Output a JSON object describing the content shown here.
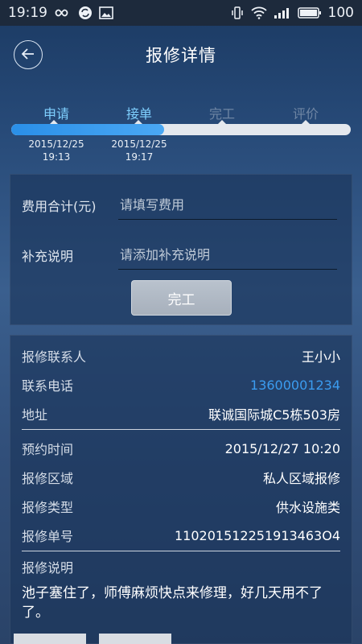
{
  "status_bar": {
    "time": "19:19",
    "battery": "100"
  },
  "header": {
    "title": "报修详情"
  },
  "progress": {
    "fraction_complete": 0.45,
    "steps": [
      {
        "label": "申请",
        "active": true,
        "date": "2015/12/25",
        "time": "19:13"
      },
      {
        "label": "接单",
        "active": true,
        "date": "2015/12/25",
        "time": "19:17"
      },
      {
        "label": "完工",
        "active": false,
        "date": "",
        "time": ""
      },
      {
        "label": "评价",
        "active": false,
        "date": "",
        "time": ""
      }
    ]
  },
  "form": {
    "cost_label": "费用合计(元)",
    "cost_placeholder": "请填写费用",
    "note_label": "补充说明",
    "note_placeholder": "请添加补充说明",
    "complete_button": "完工"
  },
  "details": {
    "contact_key": "报修联系人",
    "contact_val": "王小小",
    "phone_key": "联系电话",
    "phone_val": "13600001234",
    "address_key": "地址",
    "address_val": "联诚国际城C5栋503房",
    "appt_key": "预约时间",
    "appt_val": "2015/12/27 10:20",
    "area_key": "报修区域",
    "area_val": "私人区域报修",
    "type_key": "报修类型",
    "type_val": "供水设施类",
    "order_key": "报修单号",
    "order_val": "110201512251913463O4",
    "desc_key": "报修说明",
    "desc_val": "池子塞住了，师傅麻烦快点来修理，好几天用不了了。"
  },
  "colors": {
    "accent": "#2a8fe8",
    "active_step": "#7fd0ff",
    "phone_link": "#3b9cf0"
  }
}
